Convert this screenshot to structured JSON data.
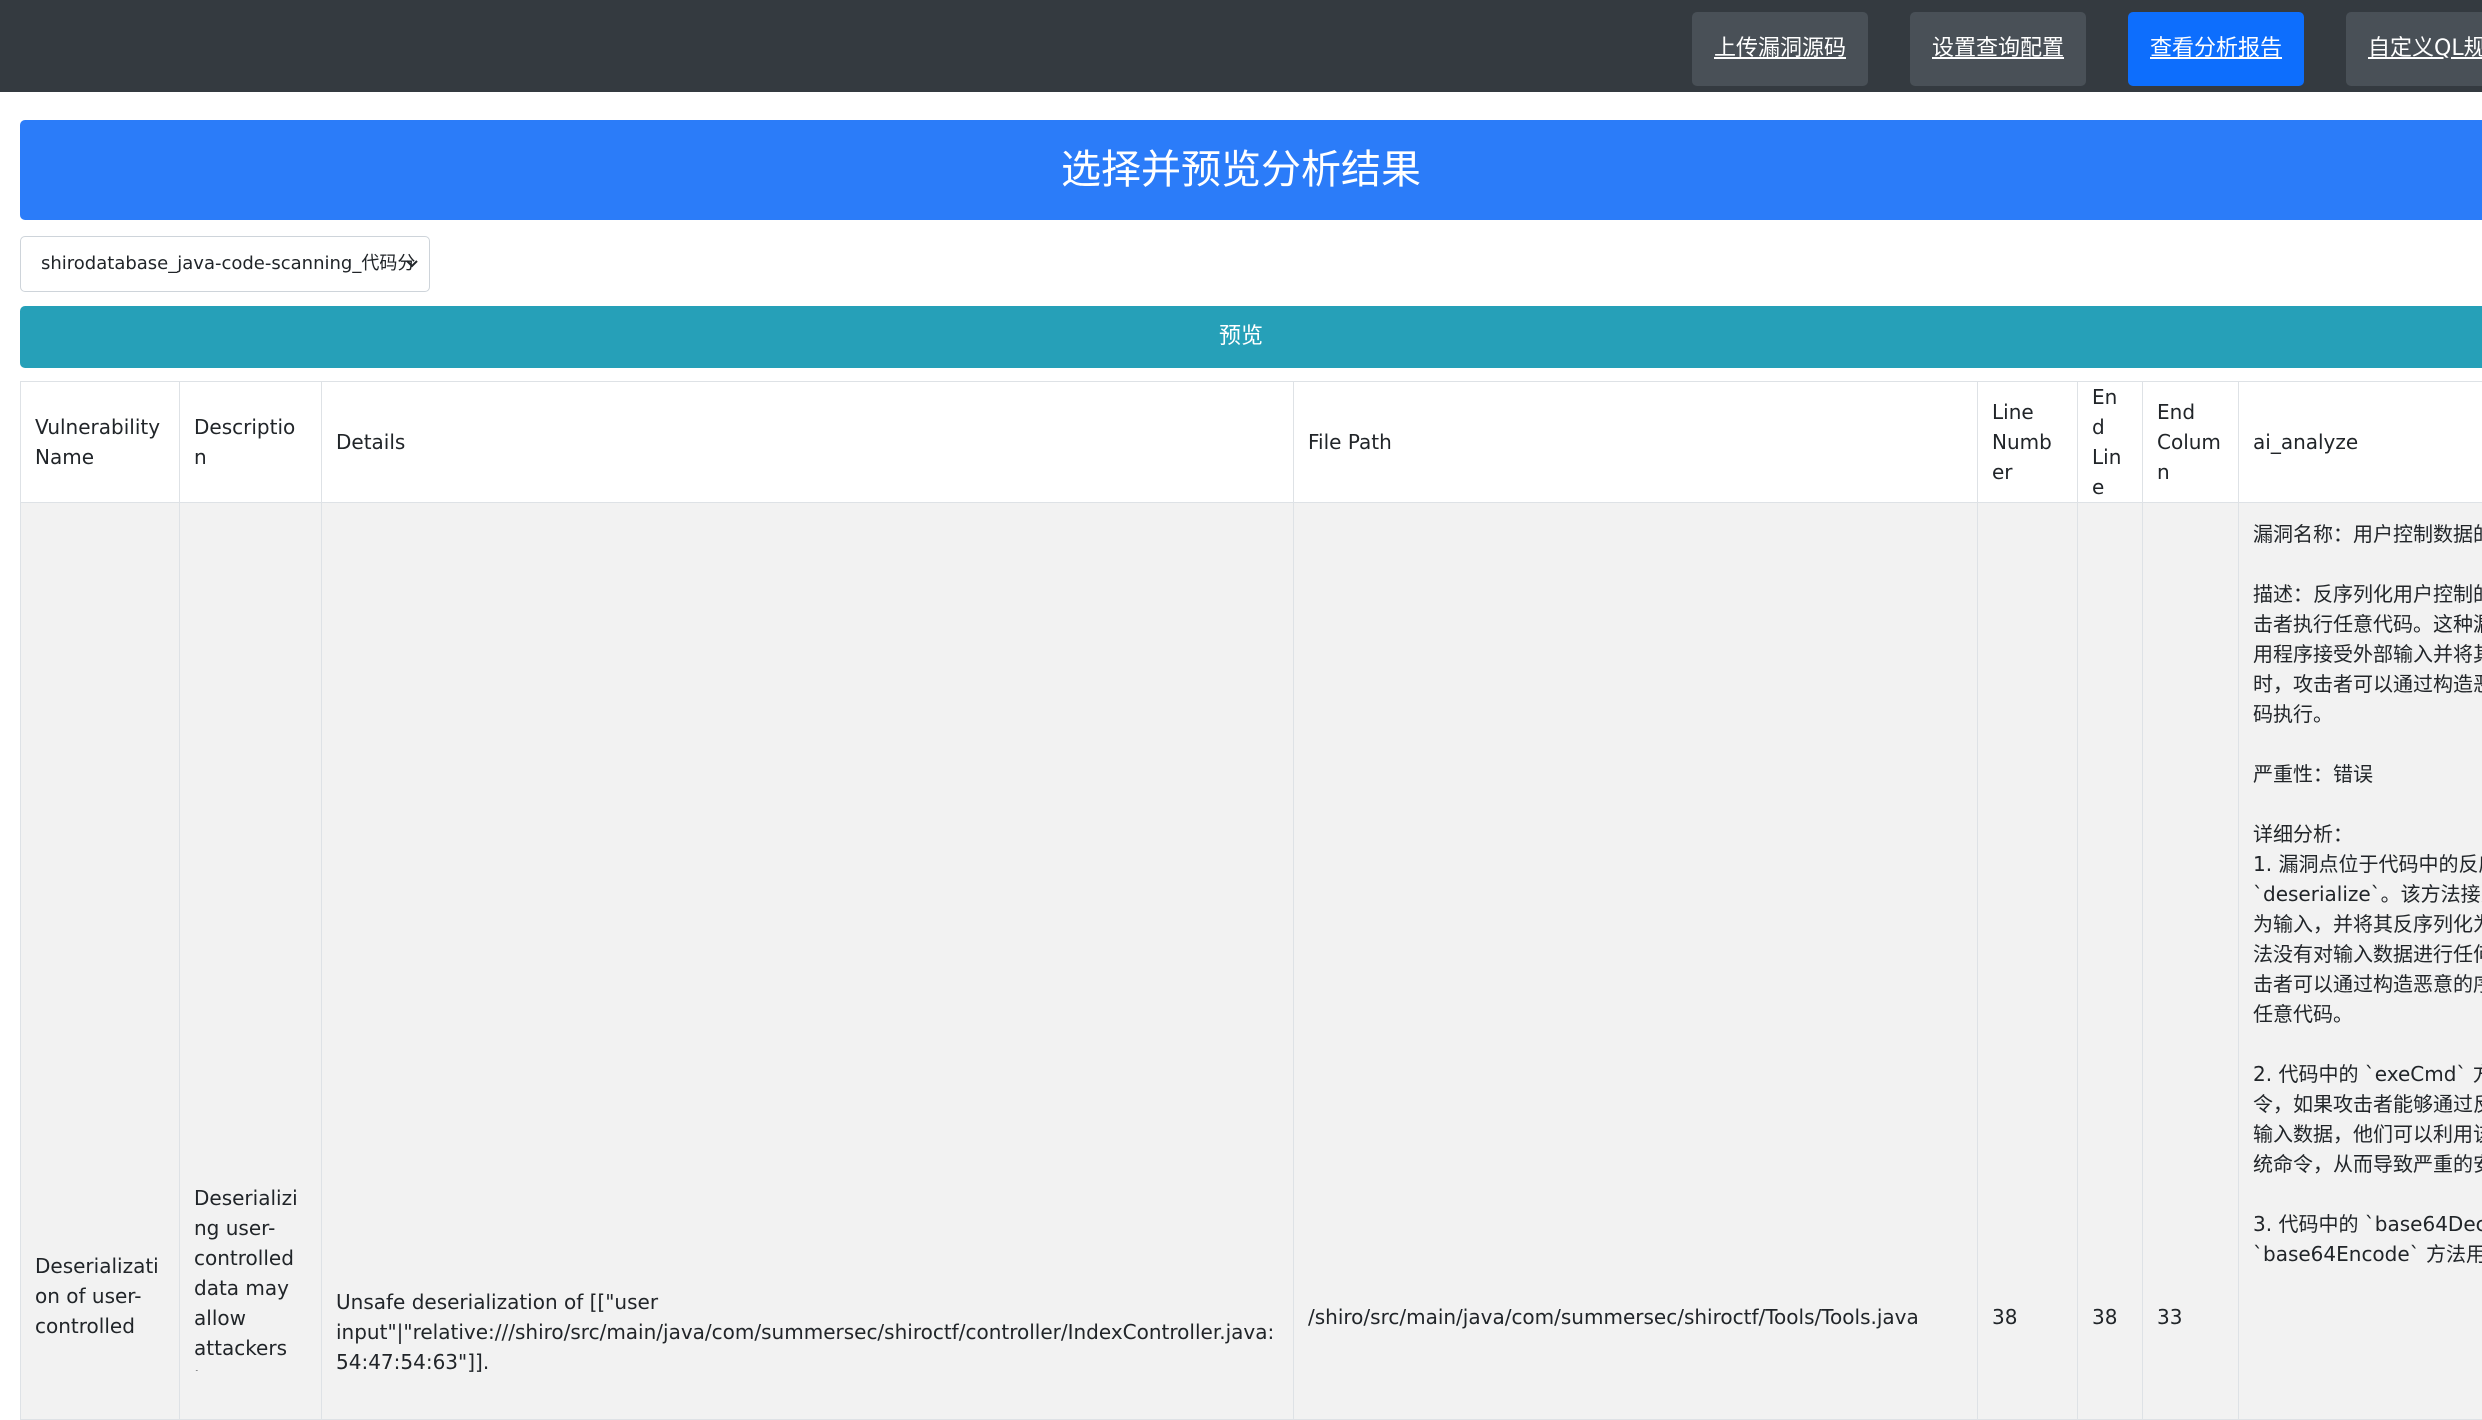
{
  "navbar": {
    "buttons": [
      {
        "label": "上传漏洞源码"
      },
      {
        "label": "设置查询配置"
      },
      {
        "label": "查看分析报告"
      },
      {
        "label": "自定义QL规则"
      }
    ]
  },
  "banner": {
    "title": "选择并预览分析结果"
  },
  "result_select": {
    "value": "shirodatabase_java-code-scanning_代码分"
  },
  "preview_button": {
    "label": "预览"
  },
  "table": {
    "headers": {
      "name": "Vulnerability Name",
      "description": "Description",
      "details": "Details",
      "file_path": "File Path",
      "line_number": "Line Number",
      "end_line": "End Line",
      "end_column": "End Column",
      "ai_analyze": "ai_analyze"
    },
    "rows": [
      {
        "name": "Deserialization of user-controlled",
        "description": "Deserializing user-controlled data may allow attackers to",
        "details": "Unsafe deserialization of [[\"user input\"|\"relative:///shiro/src/main/java/com/summersec/shiroctf/controller/IndexController.java:54:47:54:63\"]].",
        "file_path": "/shiro/src/main/java/com/summersec/shiroctf/Tools/Tools.java",
        "line_number": "38",
        "end_line": "38",
        "end_column": "33",
        "ai_analyze": "漏洞名称：用户控制数据的\n\n描述：反序列化用户控制的\n击者执行任意代码。这种漏\n用程序接受外部输入并将其\n时，攻击者可以通过构造恶\n码执行。\n\n严重性：错误\n\n详细分析：\n1. 漏洞点位于代码中的反序\n`deserialize`。该方法接受\n为输入，并将其反序列化为\n法没有对输入数据进行任何\n击者可以通过构造恶意的序\n任意代码。\n\n2. 代码中的 `exeCmd` 方法\n令，如果攻击者能够通过反\n输入数据，他们可以利用该\n统命令，从而导致严重的安\n\n3. 代码中的 `base64Deco\n`base64Encode` 方法用于"
      }
    ]
  }
}
